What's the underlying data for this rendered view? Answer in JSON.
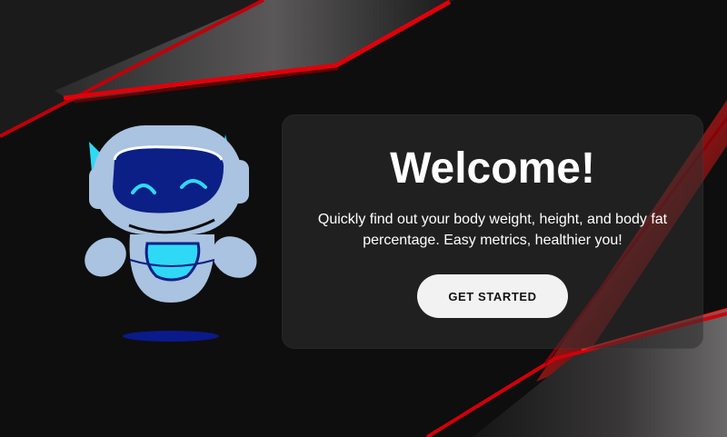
{
  "hero": {
    "title": "Welcome!",
    "description": "Quickly find out your body weight, height, and body fat percentage. Easy metrics, healthier you!",
    "cta_label": "GET STARTED"
  },
  "mascot": {
    "icon": "robot-mascot-icon"
  },
  "colors": {
    "background": "#0e0e0e",
    "accent_red": "#e0000a",
    "robot_body": "#a9c3e0",
    "robot_visor": "#0b1f86",
    "robot_cyan": "#2fd9f5",
    "button_bg": "#f2f2f2"
  }
}
